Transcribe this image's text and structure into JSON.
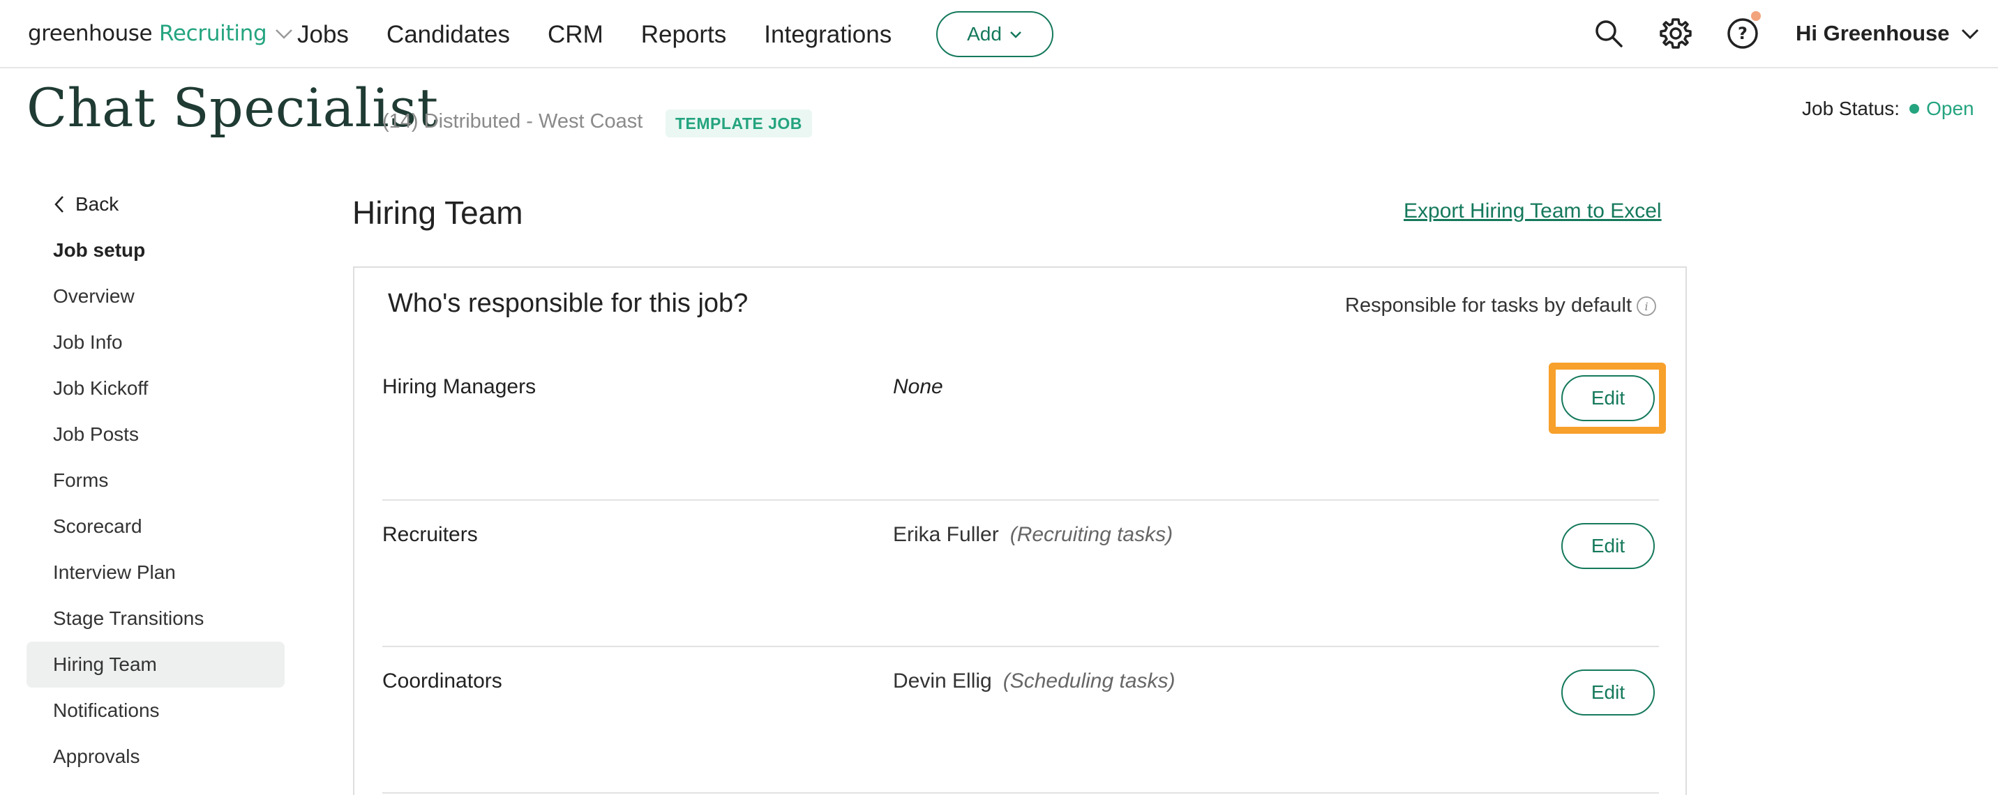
{
  "logo": {
    "brand": "greenhouse",
    "product": "Recruiting"
  },
  "nav": {
    "links": [
      "Jobs",
      "Candidates",
      "CRM",
      "Reports",
      "Integrations"
    ],
    "add_label": "Add"
  },
  "user": {
    "greeting": "Hi Greenhouse"
  },
  "icons": [
    "search-icon",
    "gear-icon",
    "help-icon",
    "chevron-down-icon",
    "info-icon"
  ],
  "job": {
    "title": "Chat Specialist",
    "meta": "(14)  Distributed - West Coast",
    "badge": "TEMPLATE JOB",
    "status_label": "Job Status:",
    "status_value": "Open"
  },
  "sidebar": {
    "back_label": "Back",
    "section_heading": "Job setup",
    "items": [
      "Overview",
      "Job Info",
      "Job Kickoff",
      "Job Posts",
      "Forms",
      "Scorecard",
      "Interview Plan",
      "Stage Transitions",
      "Hiring Team",
      "Notifications",
      "Approvals"
    ],
    "active_item": "Hiring Team"
  },
  "main": {
    "title": "Hiring Team",
    "export_label": "Export Hiring Team to Excel",
    "question": "Who's responsible for this job?",
    "responsible_default": "Responsible for tasks by default",
    "rows": [
      {
        "label": "Hiring Managers",
        "value": "None",
        "task": "",
        "edit": "Edit",
        "highlighted": true
      },
      {
        "label": "Recruiters",
        "value": "Erika Fuller",
        "task": "(Recruiting tasks)",
        "edit": "Edit",
        "highlighted": false
      },
      {
        "label": "Coordinators",
        "value": "Devin Ellig",
        "task": "(Scheduling tasks)",
        "edit": "Edit",
        "highlighted": false
      }
    ]
  },
  "colors": {
    "brand_green": "#15795c",
    "accent_green": "#24a47f",
    "highlight_orange": "#f7a02b",
    "notification": "#f2a47c"
  }
}
